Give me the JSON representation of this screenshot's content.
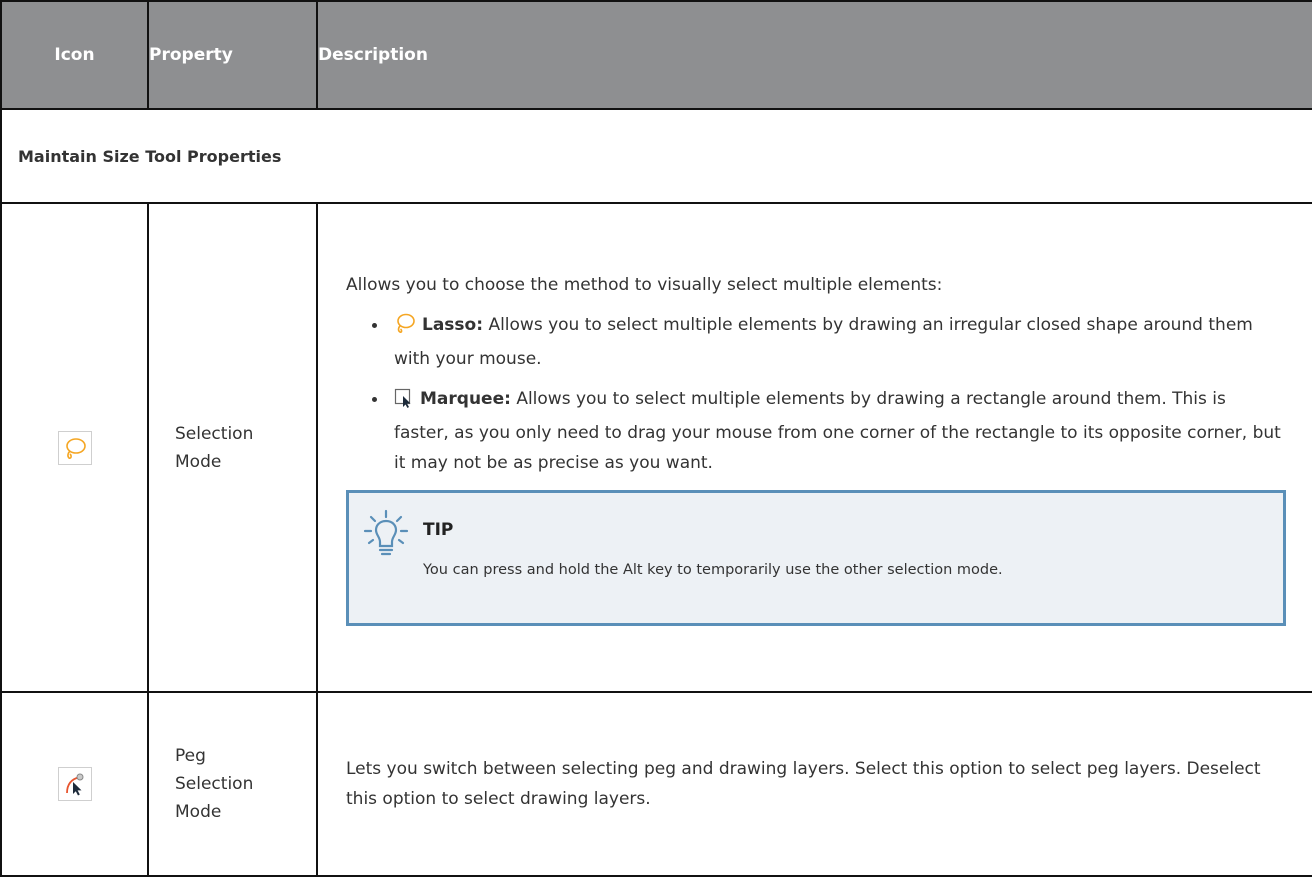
{
  "headers": {
    "icon": "Icon",
    "property": "Property",
    "description": "Description"
  },
  "section_title": "Maintain Size Tool Properties",
  "rows": [
    {
      "icon": "lasso-icon",
      "property_lines": [
        "Selection",
        "Mode"
      ],
      "description": {
        "intro": "Allows you to choose the method to visually select multiple elements:",
        "items": [
          {
            "icon": "lasso-icon",
            "label": "Lasso:",
            "text": "Allows you to select multiple elements by drawing an irregular closed shape around them with your mouse."
          },
          {
            "icon": "marquee-icon",
            "label": "Marquee:",
            "text": "Allows you to select multiple elements by drawing a rectangle around them. This is faster, as you only need to drag your mouse from one corner of the rectangle to its opposite corner, but it may not be as precise as you want."
          }
        ],
        "tip": {
          "icon": "lightbulb-icon",
          "title": "TIP",
          "text": "You can press and hold the Alt key to temporarily use the other selection mode."
        }
      }
    },
    {
      "icon": "peg-selection-icon",
      "property_lines": [
        "Peg",
        "Selection",
        "Mode"
      ],
      "description": {
        "text": "Lets you switch between selecting peg and drawing layers. Select this option to select peg layers. Deselect this option to select drawing layers."
      }
    }
  ],
  "colors": {
    "header_bg": "#8e8f91",
    "accent_orange": "#f5a623",
    "tip_border": "#5a8fb8",
    "tip_bg": "#edf1f5"
  }
}
